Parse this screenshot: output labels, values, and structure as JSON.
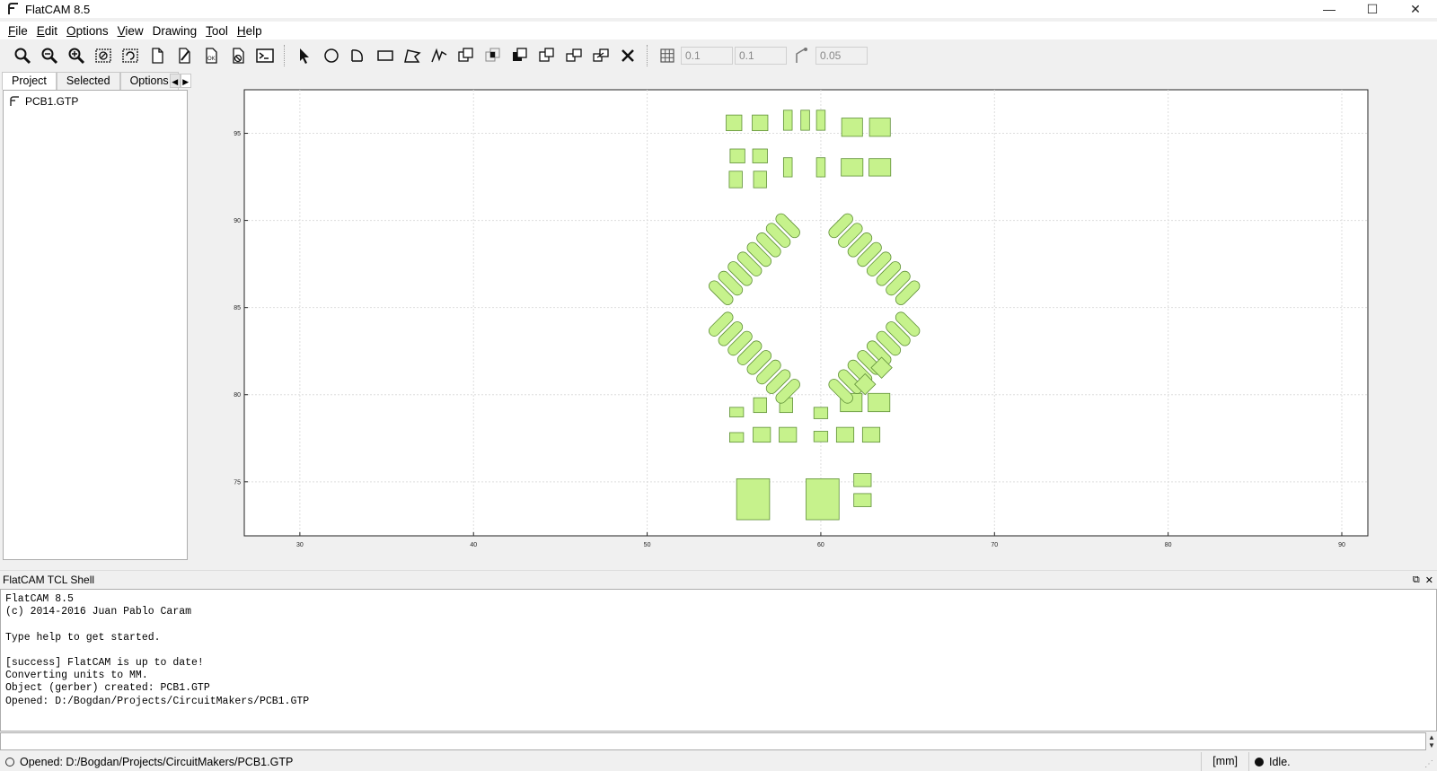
{
  "window": {
    "title": "FlatCAM 8.5",
    "minimize_glyph": "—",
    "maximize_glyph": "☐",
    "close_glyph": "✕"
  },
  "menu": [
    {
      "prefix": "",
      "underline": "F",
      "rest": "ile"
    },
    {
      "prefix": "",
      "underline": "E",
      "rest": "dit"
    },
    {
      "prefix": "",
      "underline": "O",
      "rest": "ptions"
    },
    {
      "prefix": "",
      "underline": "V",
      "rest": "iew"
    },
    {
      "prefix": "",
      "underline": "",
      "rest": "Drawing"
    },
    {
      "prefix": "",
      "underline": "T",
      "rest": "ool"
    },
    {
      "prefix": "",
      "underline": "H",
      "rest": "elp"
    }
  ],
  "toolbar": {
    "grid_x": "0.1",
    "grid_y": "0.1",
    "snap_max": "0.05"
  },
  "tabs": {
    "project": "Project",
    "selected": "Selected",
    "options": "Options"
  },
  "project_tree": {
    "items": [
      "PCB1.GTP"
    ]
  },
  "shell": {
    "title": "FlatCAM TCL Shell",
    "output": "FlatCAM 8.5\n(c) 2014-2016 Juan Pablo Caram\n\nType help to get started.\n\n[success] FlatCAM is up to date!\nConverting units to MM.\nObject (gerber) created: PCB1.GTP\nOpened: D:/Bogdan/Projects/CircuitMakers/PCB1.GTP",
    "input": ""
  },
  "status": {
    "message": "Opened: D:/Bogdan/Projects/CircuitMakers/PCB1.GTP",
    "units": "[mm]",
    "state": "Idle."
  },
  "colors": {
    "pad_fill": "#c6f28c",
    "pad_stroke": "#5e8f36",
    "grid": "#dddddd"
  },
  "chart_data": {
    "type": "scatter",
    "x_ticks": [
      "30",
      "40",
      "50",
      "60",
      "70",
      "80",
      "90"
    ],
    "y_ticks": [
      "95",
      "90",
      "85",
      "80",
      "75"
    ],
    "xlim": [
      26.8,
      91.5
    ],
    "ylim": [
      71.9,
      97.5
    ],
    "grid": true,
    "rect_pads": [
      [
        55.0,
        95.6,
        0.9,
        0.9
      ],
      [
        56.5,
        95.6,
        0.9,
        0.9
      ],
      [
        58.1,
        95.75,
        0.5,
        1.15
      ],
      [
        59.1,
        95.75,
        0.5,
        1.15
      ],
      [
        60.0,
        95.75,
        0.5,
        1.15
      ],
      [
        61.8,
        95.35,
        1.2,
        1.05
      ],
      [
        63.4,
        95.35,
        1.2,
        1.05
      ],
      [
        55.2,
        93.7,
        0.85,
        0.8
      ],
      [
        56.5,
        93.7,
        0.85,
        0.8
      ],
      [
        55.1,
        92.35,
        0.75,
        0.95
      ],
      [
        56.5,
        92.35,
        0.75,
        0.95
      ],
      [
        58.1,
        93.05,
        0.5,
        1.1
      ],
      [
        60.0,
        93.05,
        0.5,
        1.1
      ],
      [
        61.8,
        93.05,
        1.25,
        1.0
      ],
      [
        63.4,
        93.05,
        1.25,
        1.0
      ],
      [
        55.15,
        79.0,
        0.8,
        0.55
      ],
      [
        56.5,
        79.4,
        0.75,
        0.85
      ],
      [
        58.0,
        79.4,
        0.75,
        0.85
      ],
      [
        60.0,
        78.95,
        0.8,
        0.65
      ],
      [
        61.75,
        79.55,
        1.25,
        1.05
      ],
      [
        63.35,
        79.55,
        1.25,
        1.05
      ],
      [
        55.15,
        77.55,
        0.8,
        0.55
      ],
      [
        56.6,
        77.7,
        1.0,
        0.85
      ],
      [
        58.1,
        77.7,
        1.0,
        0.85
      ],
      [
        60.0,
        77.6,
        0.8,
        0.6
      ],
      [
        61.4,
        77.7,
        1.0,
        0.85
      ],
      [
        62.9,
        77.7,
        1.0,
        0.85
      ],
      [
        56.1,
        74.0,
        1.9,
        2.35
      ],
      [
        60.1,
        74.0,
        1.9,
        2.35
      ],
      [
        62.4,
        75.1,
        1.0,
        0.75
      ],
      [
        62.4,
        73.95,
        1.0,
        0.75
      ]
    ],
    "oval_pads": [
      [
        58.1,
        89.7,
        45
      ],
      [
        57.55,
        89.15,
        45
      ],
      [
        57.0,
        88.6,
        45
      ],
      [
        56.45,
        88.05,
        45
      ],
      [
        55.9,
        87.5,
        45
      ],
      [
        55.35,
        86.95,
        45
      ],
      [
        54.8,
        86.4,
        45
      ],
      [
        54.25,
        85.85,
        45
      ],
      [
        61.15,
        89.7,
        -45
      ],
      [
        61.7,
        89.15,
        -45
      ],
      [
        62.25,
        88.6,
        -45
      ],
      [
        62.8,
        88.05,
        -45
      ],
      [
        63.35,
        87.5,
        -45
      ],
      [
        63.9,
        86.95,
        -45
      ],
      [
        64.45,
        86.4,
        -45
      ],
      [
        65.0,
        85.85,
        -45
      ],
      [
        54.25,
        84.05,
        -45
      ],
      [
        54.8,
        83.5,
        -45
      ],
      [
        55.35,
        82.95,
        -45
      ],
      [
        55.9,
        82.4,
        -45
      ],
      [
        56.45,
        81.85,
        -45
      ],
      [
        57.0,
        81.3,
        -45
      ],
      [
        57.55,
        80.75,
        -45
      ],
      [
        58.1,
        80.2,
        -45
      ],
      [
        65.0,
        84.05,
        45
      ],
      [
        64.45,
        83.5,
        45
      ],
      [
        63.9,
        82.95,
        45
      ],
      [
        63.35,
        82.4,
        45
      ],
      [
        62.8,
        81.85,
        45
      ],
      [
        62.25,
        81.3,
        45
      ],
      [
        61.7,
        80.75,
        45
      ],
      [
        61.15,
        80.2,
        45
      ]
    ],
    "diamond_pads": [
      [
        63.5,
        81.55,
        0.85
      ],
      [
        62.55,
        80.6,
        0.85
      ]
    ]
  }
}
